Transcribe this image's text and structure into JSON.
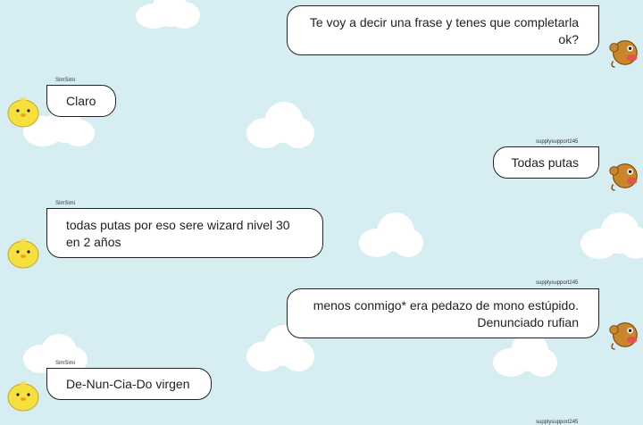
{
  "chat": {
    "partner_name": "SimSimi",
    "user_name": "supplysupport245",
    "messages": [
      {
        "sender": "user",
        "name": "supplysupport245",
        "line1": "Te voy a decir una frase y tenes que completarla",
        "line2": "ok?"
      },
      {
        "sender": "simsimi",
        "name": "SimSimi",
        "line1": "Claro",
        "line2": ""
      },
      {
        "sender": "user",
        "name": "supplysupport245",
        "line1": "Todas putas",
        "line2": ""
      },
      {
        "sender": "simsimi",
        "name": "SimSimi",
        "line1": "todas putas por eso sere wizard nivel 30",
        "line2": "en 2 años"
      },
      {
        "sender": "user",
        "name": "supplysupport245",
        "line1": "menos conmigo* era pedazo de mono estúpido.",
        "line2": "Denunciado rufian"
      },
      {
        "sender": "simsimi",
        "name": "SimSimi",
        "line1": "De-Nun-Cia-Do virgen",
        "line2": ""
      }
    ],
    "partial_name": "supplysupport245"
  },
  "colors": {
    "background": "#d6eef2",
    "bubble": "#ffffff",
    "bubble_border": "#222222",
    "simsimi_avatar": "#f6e040",
    "user_avatar": "#c9862a"
  },
  "icons": {
    "simsimi_avatar": "simsimi-chick-icon",
    "user_avatar": "monkey-avatar-icon"
  }
}
